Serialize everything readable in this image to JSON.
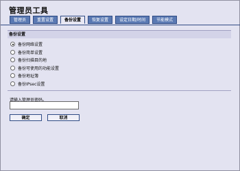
{
  "window": {
    "title": "管理员工具"
  },
  "tabs": [
    {
      "label": "管理员",
      "active": false
    },
    {
      "label": "重置设置",
      "active": false
    },
    {
      "label": "备份设置",
      "active": true
    },
    {
      "label": "恢复设置",
      "active": false
    },
    {
      "label": "设定日期/时间",
      "active": false
    },
    {
      "label": "节能模式",
      "active": false
    }
  ],
  "section": {
    "title": "备份设置",
    "options": [
      {
        "label": "备份网络设置",
        "selected": true
      },
      {
        "label": "备份简单设置",
        "selected": false
      },
      {
        "label": "备份扫描目的地",
        "selected": false
      },
      {
        "label": "备份可使用的功能设置",
        "selected": false
      },
      {
        "label": "备份地址簿",
        "selected": false
      },
      {
        "label": "备份IPsec设置",
        "selected": false
      }
    ]
  },
  "password": {
    "label": "请输入管理员密码。",
    "value": ""
  },
  "buttons": {
    "ok": "确定",
    "cancel": "取消"
  },
  "colors": {
    "tab_blue": "#5a79b3",
    "tab_border": "#2f4b84",
    "background": "#e3e3f1"
  }
}
